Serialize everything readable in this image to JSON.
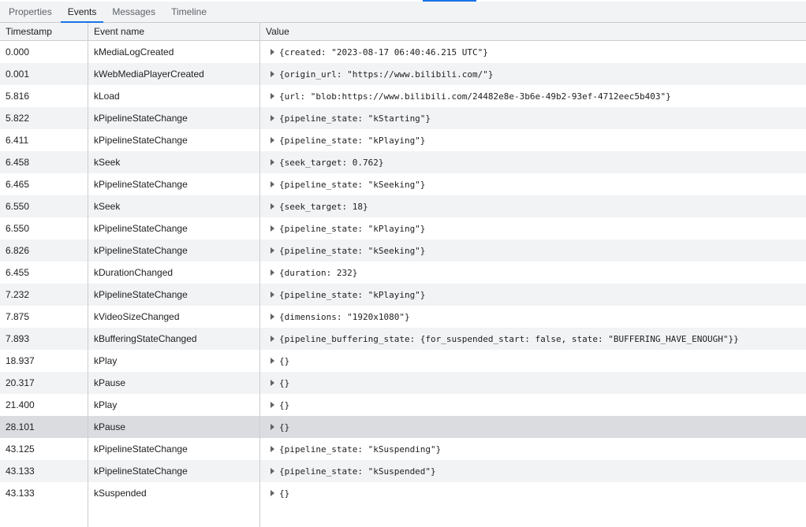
{
  "tabs": [
    {
      "label": "Properties",
      "active": false
    },
    {
      "label": "Events",
      "active": true
    },
    {
      "label": "Messages",
      "active": false
    },
    {
      "label": "Timeline",
      "active": false
    }
  ],
  "columns": {
    "timestamp": "Timestamp",
    "event_name": "Event name",
    "value": "Value"
  },
  "rows": [
    {
      "timestamp": "0.000",
      "event": "kMediaLogCreated",
      "value": "{created: \"2023-08-17 06:40:46.215 UTC\"}"
    },
    {
      "timestamp": "0.001",
      "event": "kWebMediaPlayerCreated",
      "value": "{origin_url: \"https://www.bilibili.com/\"}"
    },
    {
      "timestamp": "5.816",
      "event": "kLoad",
      "value": "{url: \"blob:https://www.bilibili.com/24482e8e-3b6e-49b2-93ef-4712eec5b403\"}"
    },
    {
      "timestamp": "5.822",
      "event": "kPipelineStateChange",
      "value": "{pipeline_state: \"kStarting\"}"
    },
    {
      "timestamp": "6.411",
      "event": "kPipelineStateChange",
      "value": "{pipeline_state: \"kPlaying\"}"
    },
    {
      "timestamp": "6.458",
      "event": "kSeek",
      "value": "{seek_target: 0.762}"
    },
    {
      "timestamp": "6.465",
      "event": "kPipelineStateChange",
      "value": "{pipeline_state: \"kSeeking\"}"
    },
    {
      "timestamp": "6.550",
      "event": "kSeek",
      "value": "{seek_target: 18}"
    },
    {
      "timestamp": "6.550",
      "event": "kPipelineStateChange",
      "value": "{pipeline_state: \"kPlaying\"}"
    },
    {
      "timestamp": "6.826",
      "event": "kPipelineStateChange",
      "value": "{pipeline_state: \"kSeeking\"}"
    },
    {
      "timestamp": "6.455",
      "event": "kDurationChanged",
      "value": "{duration: 232}"
    },
    {
      "timestamp": "7.232",
      "event": "kPipelineStateChange",
      "value": "{pipeline_state: \"kPlaying\"}"
    },
    {
      "timestamp": "7.875",
      "event": "kVideoSizeChanged",
      "value": "{dimensions: \"1920x1080\"}"
    },
    {
      "timestamp": "7.893",
      "event": "kBufferingStateChanged",
      "value": "{pipeline_buffering_state: {for_suspended_start: false, state: \"BUFFERING_HAVE_ENOUGH\"}}"
    },
    {
      "timestamp": "18.937",
      "event": "kPlay",
      "value": "{}"
    },
    {
      "timestamp": "20.317",
      "event": "kPause",
      "value": "{}"
    },
    {
      "timestamp": "21.400",
      "event": "kPlay",
      "value": "{}"
    },
    {
      "timestamp": "28.101",
      "event": "kPause",
      "value": "{}",
      "selected": true
    },
    {
      "timestamp": "43.125",
      "event": "kPipelineStateChange",
      "value": "{pipeline_state: \"kSuspending\"}"
    },
    {
      "timestamp": "43.133",
      "event": "kPipelineStateChange",
      "value": "{pipeline_state: \"kSuspended\"}"
    },
    {
      "timestamp": "43.133",
      "event": "kSuspended",
      "value": "{}"
    }
  ],
  "icons": {
    "expand": "expand-arrow-icon"
  },
  "colors": {
    "accent": "#1a73e8",
    "selected_row": "#dadce0",
    "striped_row": "#f2f3f5"
  }
}
